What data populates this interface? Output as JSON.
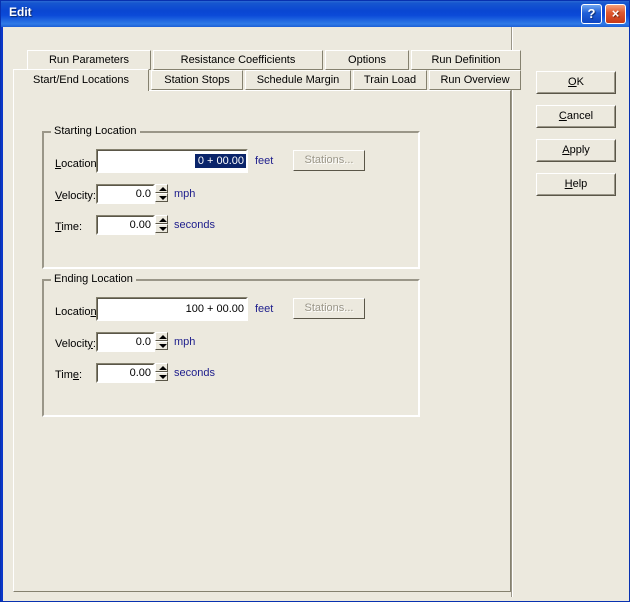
{
  "window": {
    "title": "Edit",
    "help_button": "?",
    "close_button": "×"
  },
  "tabs": {
    "row_top": [
      {
        "label": "Run Parameters",
        "active": false
      },
      {
        "label": "Resistance Coefficients",
        "active": false
      },
      {
        "label": "Options",
        "active": false
      },
      {
        "label": "Run Definition",
        "active": false
      }
    ],
    "row_bottom": [
      {
        "label": "Start/End Locations",
        "active": true
      },
      {
        "label": "Station Stops",
        "active": false
      },
      {
        "label": "Schedule Margin",
        "active": false
      },
      {
        "label": "Train Load",
        "active": false
      },
      {
        "label": "Run Overview",
        "active": false
      }
    ]
  },
  "starting_location": {
    "group_title": "Starting Location",
    "location_label": "Location:",
    "location_accel": "L",
    "location_value": "0 + 00.00",
    "location_unit": "feet",
    "stations_button": "Stations...",
    "velocity_label": "Velocity:",
    "velocity_accel": "V",
    "velocity_value": "0.0",
    "velocity_unit": "mph",
    "time_label": "Time:",
    "time_accel": "T",
    "time_value": "0.00",
    "time_unit": "seconds"
  },
  "ending_location": {
    "group_title": "Ending Location",
    "location_label": "Location:",
    "location_accel": "n",
    "location_value": "100 + 00.00",
    "location_unit": "feet",
    "stations_button": "Stations...",
    "velocity_label": "Velocity:",
    "velocity_accel": "y",
    "velocity_value": "0.0",
    "velocity_unit": "mph",
    "time_label": "Time:",
    "time_accel": "e",
    "time_value": "0.00",
    "time_unit": "seconds"
  },
  "buttons": {
    "ok": "OK",
    "ok_accel": "O",
    "cancel": "Cancel",
    "cancel_accel": "C",
    "apply": "Apply",
    "apply_accel": "A",
    "help": "Help",
    "help_accel": "H"
  },
  "colors": {
    "dialog_background": "#ECE9DE",
    "titlebar_blue": "#0A46D2",
    "selection_blue": "#0A246A",
    "unit_text_navy": "#1D1D8C",
    "close_button_red": "#E05A30"
  }
}
